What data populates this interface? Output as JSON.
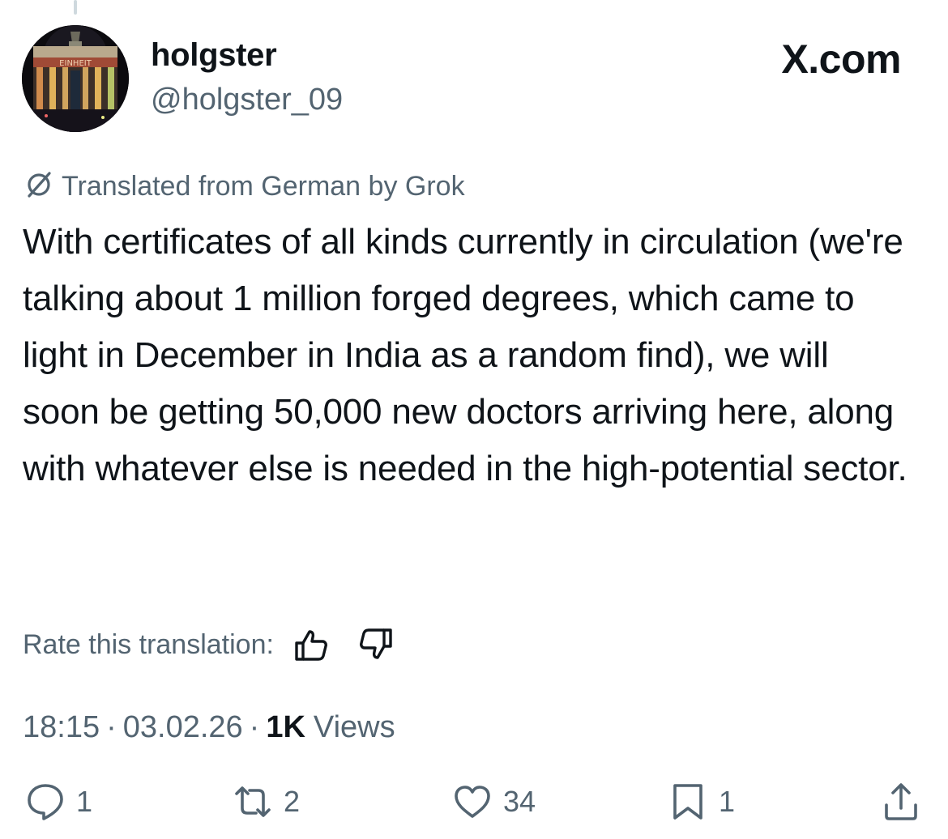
{
  "author": {
    "display_name": "holgster",
    "handle": "@holgster_09",
    "avatar": "brandenburg-gate-night-photo"
  },
  "brand": "X.com",
  "translation": {
    "note": "Translated from German by Grok",
    "icon": "grok-slash-icon",
    "rate_label": "Rate this translation:"
  },
  "post": {
    "text": "With certificates of all kinds currently in circulation (we're talking about 1 million forged degrees, which came to light in December in India as a random find), we will soon be getting 50,000 new doctors arriving here, along with whatever else is needed in the high-potential sector."
  },
  "meta": {
    "time": "18:15",
    "separator": "·",
    "date": "03.02.26",
    "views_count": "1K",
    "views_label": "Views"
  },
  "actions": {
    "replies": "1",
    "reposts": "2",
    "likes": "34",
    "bookmarks": "1"
  },
  "colors": {
    "text": "#0f1419",
    "secondary": "#536471",
    "background": "#ffffff"
  }
}
